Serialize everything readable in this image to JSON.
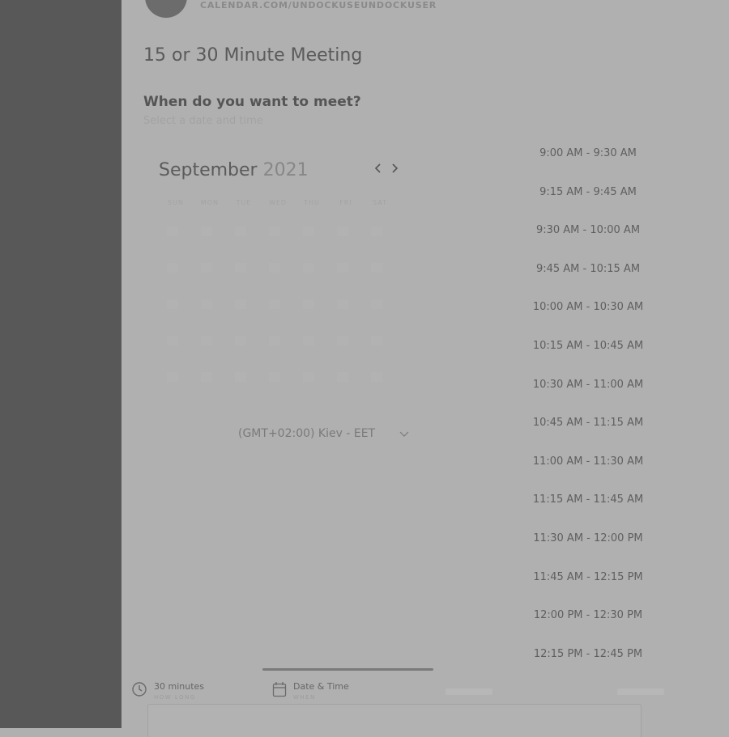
{
  "header": {
    "url": "CALENDAR.COM/UNDOCKUSEUNDOCKUSER"
  },
  "meeting": {
    "title": "15 or 30 Minute Meeting",
    "question": "When do you want to meet?",
    "subtitle": "Select a date and time"
  },
  "calendar": {
    "month": "September",
    "year": "2021",
    "prev_icon": "chevron-left-icon",
    "next_icon": "chevron-right-icon",
    "weekdays": [
      "SUN",
      "MON",
      "TUE",
      "WED",
      "THU",
      "FRI",
      "SAT"
    ]
  },
  "timezone": {
    "selected": "(GMT+02:00) Kiev - EET"
  },
  "time_slots": [
    "9:00 AM - 9:30 AM",
    "9:15 AM - 9:45 AM",
    "9:30 AM - 10:00 AM",
    "9:45 AM - 10:15 AM",
    "10:00 AM - 10:30 AM",
    "10:15 AM - 10:45 AM",
    "10:30 AM - 11:00 AM",
    "10:45 AM - 11:15 AM",
    "11:00 AM - 11:30 AM",
    "11:15 AM - 11:45 AM",
    "11:30 AM - 12:00 PM",
    "11:45 AM - 12:15 PM",
    "12:00 PM - 12:30 PM",
    "12:15 PM - 12:45 PM"
  ],
  "steps": [
    {
      "label": "30 minutes",
      "sub": "HOW LONG",
      "icon": "clock-icon"
    },
    {
      "label": "Date & Time",
      "sub": "WHEN",
      "icon": "calendar-icon"
    }
  ],
  "colors": {
    "overlay": "#b0b0b0",
    "left_panel": "#585858",
    "progress": "#7a7a7a"
  }
}
